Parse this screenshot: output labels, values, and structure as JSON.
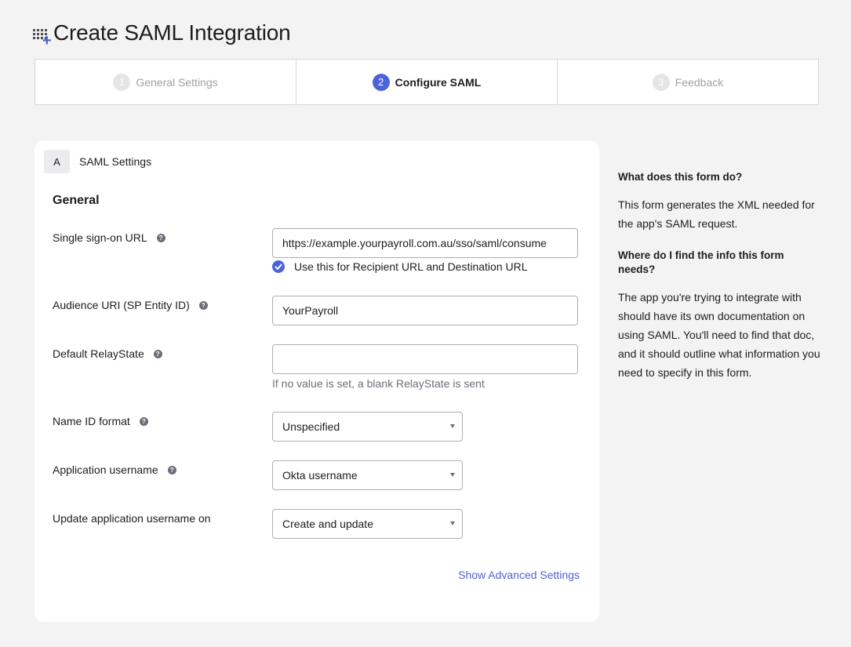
{
  "header": {
    "title": "Create SAML Integration",
    "icon": "app-grid-add-icon"
  },
  "steps": [
    {
      "num": "1",
      "label": "General Settings",
      "state": "inactive"
    },
    {
      "num": "2",
      "label": "Configure SAML",
      "state": "active"
    },
    {
      "num": "3",
      "label": "Feedback",
      "state": "inactive"
    }
  ],
  "section": {
    "letter": "A",
    "title": "SAML Settings",
    "group_title": "General"
  },
  "fields": {
    "sso_url": {
      "label": "Single sign-on URL",
      "value": "https://example.yourpayroll.com.au/sso/saml/consume",
      "checkbox_label": "Use this for Recipient URL and Destination URL",
      "checked": true
    },
    "audience_uri": {
      "label": "Audience URI (SP Entity ID)",
      "value": "YourPayroll"
    },
    "relay_state": {
      "label": "Default RelayState",
      "value": "",
      "hint": "If no value is set, a blank RelayState is sent"
    },
    "name_id_format": {
      "label": "Name ID format",
      "value": "Unspecified"
    },
    "app_username": {
      "label": "Application username",
      "value": "Okta username"
    },
    "update_username": {
      "label": "Update application username on",
      "value": "Create and update"
    }
  },
  "advanced_link": "Show Advanced Settings",
  "aside": {
    "q1": "What does this form do?",
    "a1": "This form generates the XML needed for the app's SAML request.",
    "q2": "Where do I find the info this form needs?",
    "a2": "The app you're trying to integrate with should have its own documentation on using SAML. You'll need to find that doc, and it should outline what information you need to specify in this form."
  },
  "colors": {
    "accent": "#4c64d9",
    "background": "#f3f3f3",
    "card": "#ffffff"
  }
}
